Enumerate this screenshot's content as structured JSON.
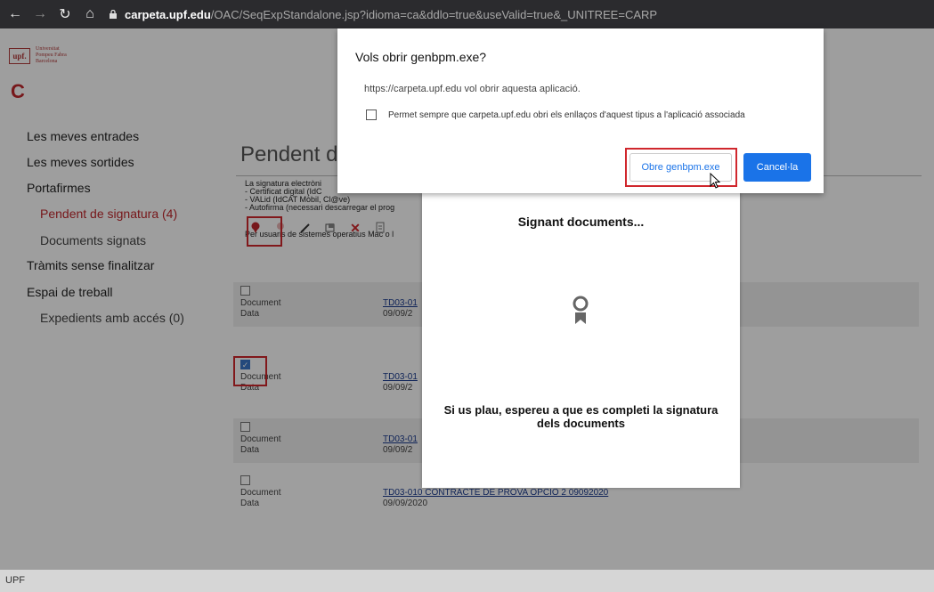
{
  "browser": {
    "url_host": "carpeta.upf.edu",
    "url_path": "/OAC/SeqExpStandalone.jsp?idioma=ca&ddlo=true&useValid=true&_UNITREE=CARP"
  },
  "logo": {
    "mark": "upf.",
    "name_line1": "Universitat",
    "name_line2": "Pompeu Fabra",
    "name_line3": "Barcelona",
    "c_letter": "C"
  },
  "sidebar": {
    "items": [
      {
        "label": "Les meves entrades"
      },
      {
        "label": "Les meves sortides"
      },
      {
        "label": "Portafirmes"
      },
      {
        "label": "Pendent de signatura (4)"
      },
      {
        "label": "Documents signats"
      },
      {
        "label": "Tràmits sense finalitzar"
      },
      {
        "label": "Espai de treball"
      },
      {
        "label": "Expedients amb accés (0)"
      }
    ]
  },
  "main": {
    "title": "Pendent de",
    "info_lines": [
      "La signatura electròni",
      "- Certificat digital (IdC",
      "- VALid (IdCAT Mòbil, Cl@ve)",
      "- Autofirma (necessari descarregar el prog"
    ],
    "info_mac": "Per usuaris de sistemes operatius Mac o l"
  },
  "documents": [
    {
      "label_doc": "Document",
      "doc_value": "TD03-01",
      "label_date": "Data",
      "date_value": "09/09/2",
      "checked": false
    },
    {
      "label_doc": "Document",
      "doc_value": "TD03-01",
      "label_date": "Data",
      "date_value": "09/09/2",
      "checked": true
    },
    {
      "label_doc": "Document",
      "doc_value": "TD03-01",
      "label_date": "Data",
      "date_value": "09/09/2",
      "checked": false
    },
    {
      "label_doc": "Document",
      "doc_value": "TD03-010 CONTRACTE DE PROVA OPCIO 2 09092020",
      "label_date": "Data",
      "date_value": "09/09/2020",
      "checked": false
    }
  ],
  "signing_panel": {
    "title": "Signant documents...",
    "wait_line1": "Si us plau, espereu a que es completi la signatura",
    "wait_line2": "dels documents"
  },
  "dialog": {
    "title": "Vols obrir genbpm.exe?",
    "message": "https://carpeta.upf.edu vol obrir aquesta aplicació.",
    "checkbox_label": "Permet sempre que carpeta.upf.edu obri els enllaços d'aquest tipus a l'aplicació associada",
    "open_button": "Obre genbpm.exe",
    "cancel_button": "Cancel·la"
  },
  "footer": {
    "text": "UPF"
  },
  "colors": {
    "accent": "#c0272d",
    "highlight": "#d0272d",
    "primary_button": "#1a73e8"
  }
}
